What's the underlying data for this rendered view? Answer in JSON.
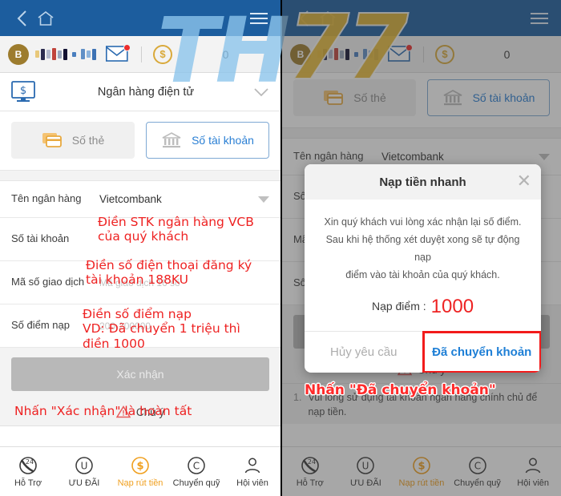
{
  "appbar": {
    "back_icon": "chevron-left-icon",
    "home_icon": "home-icon",
    "menu_icon": "hamburger-menu-icon"
  },
  "account_bar": {
    "avatar_initial": "B",
    "username_masked": "",
    "mail_icon": "envelope-icon",
    "coin_icon": "dollar-coin-icon",
    "balance": "0"
  },
  "section": {
    "icon": "monitor-dollar-icon",
    "title": "Ngân hàng điện tử",
    "chevron_icon": "chevron-down-icon"
  },
  "tabs": [
    {
      "label": "Số thẻ",
      "icon": "credit-card-icon",
      "active": false
    },
    {
      "label": "Số tài khoản",
      "icon": "bank-icon",
      "active": true
    }
  ],
  "form": {
    "bank_name": {
      "label": "Tên ngân hàng",
      "value": "Vietcombank"
    },
    "account_number": {
      "label": "Số tài khoản",
      "placeholder": ""
    },
    "transaction_code": {
      "label": "Mã số giao dịch",
      "placeholder": "Mã giao dịch 16 số"
    },
    "deposit_points": {
      "label": "Số điểm nạp",
      "placeholder": "200-200000"
    },
    "confirm_label": "Xác nhận"
  },
  "notice": {
    "warning_icon": "warning-triangle-icon",
    "title": "Chú ý",
    "items": [
      {
        "num": "1.",
        "text": "Vui lòng sử dụng tài khoản ngân hàng chính chủ để nạp tiền."
      }
    ]
  },
  "bottom_nav": [
    {
      "label": "Hỗ Trợ",
      "icon": "support-24-icon",
      "active": false
    },
    {
      "label": "ƯU ĐÃI",
      "icon": "promo-u-icon",
      "active": false
    },
    {
      "label": "Nạp rút tiền",
      "icon": "deposit-dollar-icon",
      "active": true
    },
    {
      "label": "Chuyển quỹ",
      "icon": "transfer-c-icon",
      "active": false
    },
    {
      "label": "Hội viên",
      "icon": "member-person-icon",
      "active": false
    }
  ],
  "modal": {
    "title": "Nạp tiền nhanh",
    "close_icon": "close-x-icon",
    "line1": "Xin quý khách vui lòng xác nhận lại số điểm.",
    "line2": "Sau khi hệ thống xét duyệt xong sẽ tự động nạp",
    "line3": "điểm vào tài khoản của quý khách.",
    "points_label": "Nạp điểm :",
    "points_value": "1000",
    "cancel_label": "Hủy yêu cầu",
    "confirm_label": "Đã chuyển khoản"
  },
  "annotations": {
    "left": [
      "Điền STK ngân hàng VCB",
      "của quý khách",
      "Điền số điện thoại đăng ký",
      "tài khoản 188KU",
      "Điền số điểm nạp",
      "VD: Đã chuyển 1 triệu thì",
      "điền 1000",
      "Nhấn \"Xác nhận\" là hoàn tất"
    ],
    "right": "Nhấn \"Đã chuyển khoản\""
  },
  "watermark": {
    "left_text": "TH",
    "right_text": "77"
  },
  "colors": {
    "header_blue": "#1c5d9e",
    "accent_orange": "#f0a020",
    "link_blue": "#2a7fd4",
    "annotation_red": "#ee2222",
    "highlight_red": "#f21b1b"
  }
}
